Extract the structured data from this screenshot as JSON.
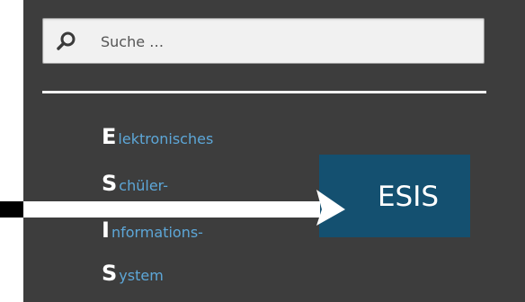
{
  "search": {
    "placeholder": "Suche …",
    "icon": "search-icon"
  },
  "acronym": [
    {
      "letter": "E",
      "rest": "lektronisches"
    },
    {
      "letter": "S",
      "rest": "chüler-"
    },
    {
      "letter": "I",
      "rest": "nformations-"
    },
    {
      "letter": "S",
      "rest": "ystem"
    }
  ],
  "badge": {
    "label": "ESIS"
  },
  "colors": {
    "panel_background": "#3d3d3d",
    "accent_link": "#5da7d8",
    "badge_background": "#145070",
    "arrow": "#ffffff"
  }
}
